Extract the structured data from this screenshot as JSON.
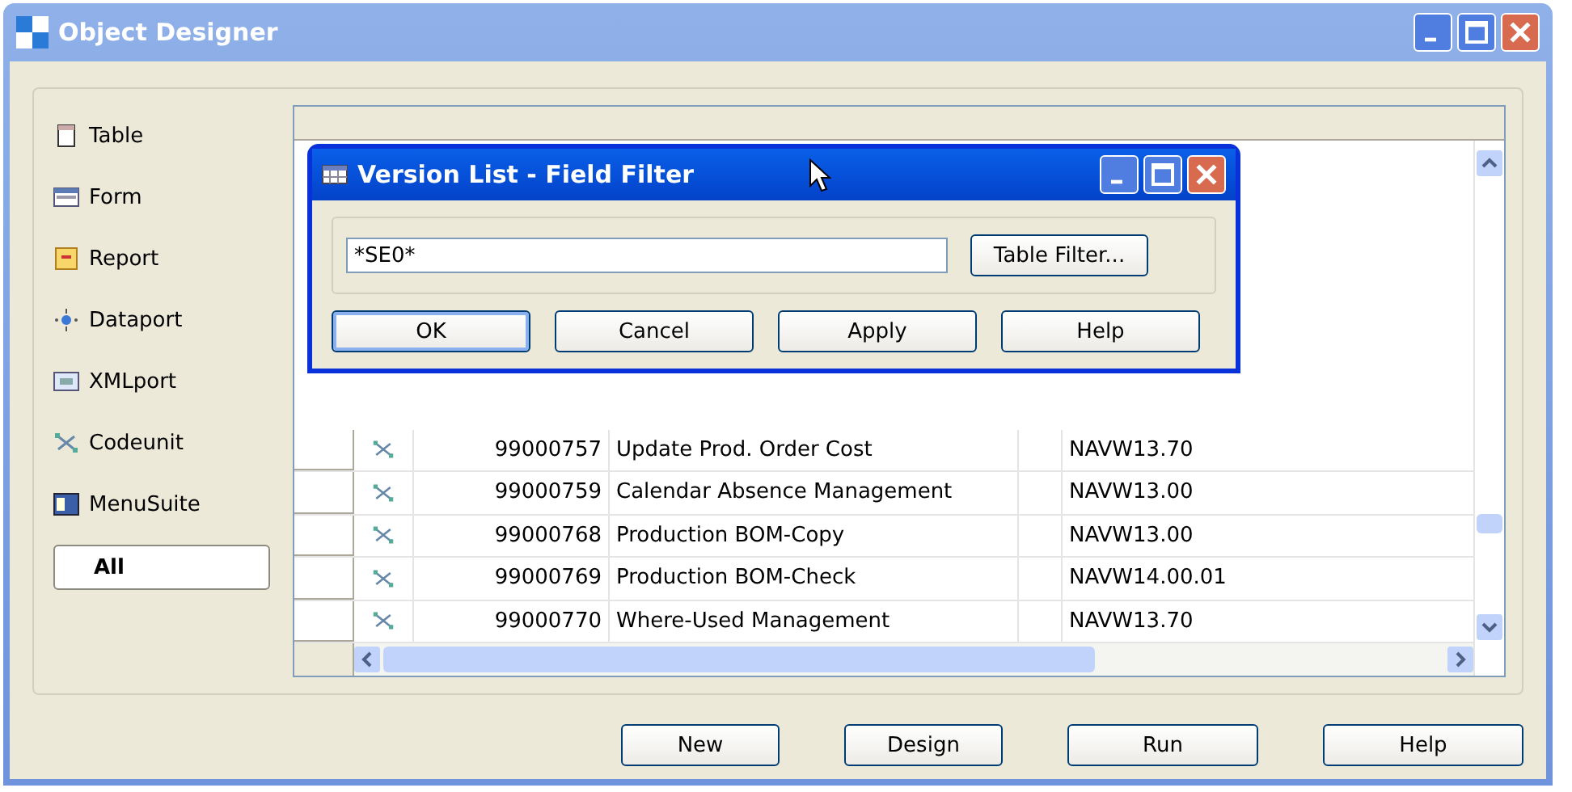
{
  "window": {
    "title": "Object Designer"
  },
  "sidebar": {
    "items": [
      {
        "kind": "table",
        "label": "Table",
        "selected": false
      },
      {
        "kind": "form",
        "label": "Form",
        "selected": false
      },
      {
        "kind": "report",
        "label": "Report",
        "selected": false
      },
      {
        "kind": "dataport",
        "label": "Dataport",
        "selected": false
      },
      {
        "kind": "xmlport",
        "label": "XMLport",
        "selected": false
      },
      {
        "kind": "codeunit",
        "label": "Codeunit",
        "selected": false
      },
      {
        "kind": "menusuite",
        "label": "MenuSuite",
        "selected": false
      },
      {
        "kind": "all",
        "label": "All",
        "selected": true
      }
    ]
  },
  "table": {
    "rows": [
      {
        "kind": "codeunit",
        "id": "99000757",
        "name": "Update Prod. Order Cost",
        "version": "NAVW13.70"
      },
      {
        "kind": "codeunit",
        "id": "99000759",
        "name": "Calendar Absence Management",
        "version": "NAVW13.00"
      },
      {
        "kind": "codeunit",
        "id": "99000768",
        "name": "Production BOM-Copy",
        "version": "NAVW13.00"
      },
      {
        "kind": "codeunit",
        "id": "99000769",
        "name": "Production BOM-Check",
        "version": "NAVW14.00.01"
      },
      {
        "kind": "codeunit",
        "id": "99000770",
        "name": "Where-Used Management",
        "version": "NAVW13.70"
      }
    ]
  },
  "buttons": [
    "New",
    "Design",
    "Run",
    "Help"
  ],
  "dialog": {
    "title": "Version List - Field Filter",
    "filter_value": "*SE0*",
    "table_filter_button": "Table Filter...",
    "buttons": [
      "OK",
      "Cancel",
      "Apply",
      "Help"
    ]
  }
}
